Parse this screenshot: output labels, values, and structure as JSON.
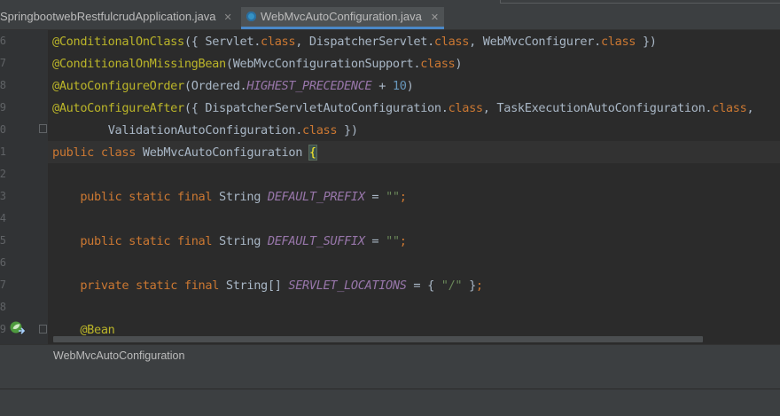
{
  "tabs": [
    {
      "label": "SpringbootwebRestfulcrudApplication.java",
      "close": "✕"
    },
    {
      "label": "WebMvcAutoConfiguration.java",
      "close": "✕"
    }
  ],
  "gutter": {
    "line_numbers": [
      "6",
      "7",
      "8",
      "9",
      "0",
      "1",
      "2",
      "3",
      "4",
      "5",
      "6",
      "7",
      "8",
      "9"
    ]
  },
  "code": {
    "l1": {
      "ann": "@ConditionalOnClass",
      "a": "({ Servlet.",
      "k1": "class",
      "b": ", DispatcherServlet.",
      "k2": "class",
      "c": ", WebMvcConfigurer.",
      "k3": "class",
      "d": " })"
    },
    "l2": {
      "ann": "@ConditionalOnMissingBean",
      "a": "(WebMvcConfigurationSupport.",
      "k1": "class",
      "d": ")"
    },
    "l3": {
      "ann": "@AutoConfigureOrder",
      "a": "(Ordered.",
      "cst": "HIGHEST_PRECEDENCE",
      "b": " + ",
      "num": "10",
      "d": ")"
    },
    "l4": {
      "ann": "@AutoConfigureAfter",
      "a": "({ DispatcherServletAutoConfiguration.",
      "k1": "class",
      "b": ", TaskExecutionAutoConfiguration.",
      "k2": "class",
      "d": ","
    },
    "l5": {
      "indent": "        ",
      "a": "ValidationAutoConfiguration.",
      "k1": "class",
      "d": " })"
    },
    "l6": {
      "k1": "public",
      "s1": " ",
      "k2": "class",
      "name": " WebMvcAutoConfiguration ",
      "brace": "{"
    },
    "l8": {
      "indent": "    ",
      "k1": "public static final",
      "type": " String ",
      "cst": "DEFAULT_PREFIX",
      "eq": " = ",
      "str": "\"\"",
      "semi": ";"
    },
    "l10": {
      "indent": "    ",
      "k1": "public static final",
      "type": " String ",
      "cst": "DEFAULT_SUFFIX",
      "eq": " = ",
      "str": "\"\"",
      "semi": ";"
    },
    "l12": {
      "indent": "    ",
      "k1": "private static final",
      "type": " String[] ",
      "cst": "SERVLET_LOCATIONS",
      "eq": " = { ",
      "str": "\"/\"",
      "end": " }",
      "semi": ";"
    },
    "l14": {
      "indent": "    ",
      "ann": "@Bean"
    }
  },
  "breadcrumb": "WebMvcAutoConfiguration",
  "colors": {
    "background": "#2b2b2b",
    "annotation": "#bbb529",
    "keyword": "#cc7832",
    "constant": "#9876aa",
    "number": "#6897bb",
    "string": "#6a8759",
    "text": "#a9b7c6"
  },
  "icons": {
    "file": "java-class-file-icon",
    "bean": "spring-bean-gutter-icon"
  }
}
